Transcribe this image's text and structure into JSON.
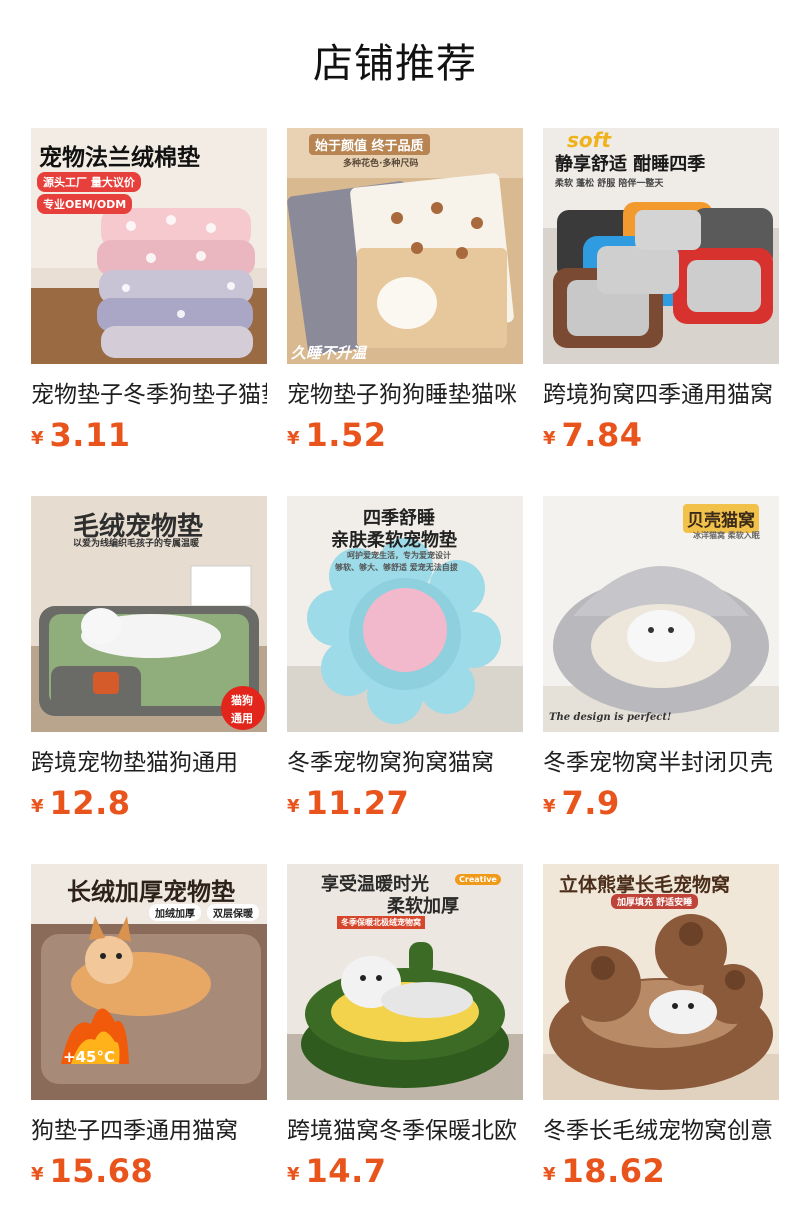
{
  "page": {
    "title": "店铺推荐"
  },
  "products": [
    {
      "name": "宠物垫子冬季狗垫子猫垫",
      "currency": "¥",
      "price": "3.11",
      "image_texts": [
        "宠物法兰绒棉垫",
        "源头工厂 量大议价",
        "专业OEM/ODM"
      ]
    },
    {
      "name": "宠物垫子狗狗睡垫猫咪",
      "currency": "¥",
      "price": "1.52",
      "image_texts": [
        "始于颜值 终于品质",
        "多种花色·多种尺码",
        "久睡不升温"
      ]
    },
    {
      "name": "跨境狗窝四季通用猫窝",
      "currency": "¥",
      "price": "7.84",
      "image_texts": [
        "soft",
        "静享舒适 酣睡四季",
        "柔软 蓬松 舒服 陪伴一整天"
      ]
    },
    {
      "name": "跨境宠物垫猫狗通用",
      "currency": "¥",
      "price": "12.8",
      "image_texts": [
        "毛绒宠物垫",
        "以爱为线编织毛孩子的专属温暖",
        "猫狗",
        "通用"
      ]
    },
    {
      "name": "冬季宠物窝狗窝猫窝",
      "currency": "¥",
      "price": "11.27",
      "image_texts": [
        "四季舒睡",
        "亲肤柔软宠物垫",
        "呵护爱宠生活，专为爱宠设计",
        "够软、够大、够舒适 爱宠无法自拔"
      ]
    },
    {
      "name": "冬季宠物窝半封闭贝壳",
      "currency": "¥",
      "price": "7.9",
      "image_texts": [
        "贝壳猫窝",
        "冰洋猫窝 柔软入眠",
        "The design is perfect!"
      ]
    },
    {
      "name": "狗垫子四季通用猫窝",
      "currency": "¥",
      "price": "15.68",
      "image_texts": [
        "长绒加厚宠物垫",
        "加绒加厚",
        "双层保暖",
        "+45°C"
      ]
    },
    {
      "name": "跨境猫窝冬季保暖北欧",
      "currency": "¥",
      "price": "14.7",
      "image_texts": [
        "享受温暖时光",
        "Creative",
        "柔软加厚",
        "冬季保暖北极绒宠物窝"
      ]
    },
    {
      "name": "冬季长毛绒宠物窝创意",
      "currency": "¥",
      "price": "18.62",
      "image_texts": [
        "立体熊掌长毛宠物窝",
        "加厚填充 舒适安睡"
      ]
    }
  ],
  "colors": {
    "price": "#e8541c",
    "text": "#1f1f1f",
    "background": "#ffffff"
  }
}
